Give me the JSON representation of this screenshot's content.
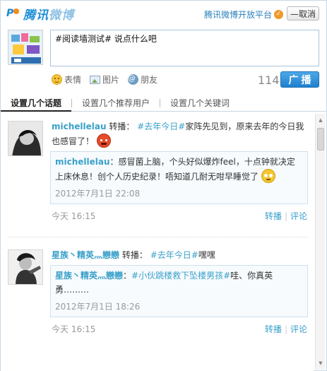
{
  "header": {
    "logo_text": "腾讯",
    "logo_text_2": "微博",
    "platform_link": "腾讯微博开放平台",
    "cancel_label": "—取消"
  },
  "composer": {
    "text": "#阅读墙测试# 说点什么吧",
    "tools": [
      {
        "icon": "smiley-icon",
        "label": "表情"
      },
      {
        "icon": "image-icon",
        "label": "图片"
      },
      {
        "icon": "at-icon",
        "label": "朋友"
      }
    ],
    "remaining_chars": "114",
    "submit_label": "广播"
  },
  "tabs": [
    {
      "label": "设置几个话题",
      "active": true
    },
    {
      "label": "设置几个推荐用户",
      "active": false
    },
    {
      "label": "设置几个关键词",
      "active": false
    }
  ],
  "posts": [
    {
      "user": "michellelau",
      "action": "转播：",
      "topic": "#去年今日#",
      "text": "家阵先见到，原来去年的今日我也感冒了！",
      "emoji": "angry-face-icon",
      "inner": {
        "user": "michellelau",
        "text": "：感冒菌上脑，个头好似爆炸feel，十点钟就决定上床休息！创个人历史纪录！唔知道几耐无咁早睡觉了",
        "emoji": "crying-face-icon",
        "time": "2012年7月1日 22:08"
      },
      "time": "今天 16:15",
      "actions": [
        "转播",
        "评论"
      ]
    },
    {
      "user": "星族丶精英灬戀戀",
      "action": "转播：",
      "topic": "#去年今日#",
      "text": "嘿嘿",
      "inner": {
        "user": "星族丶精英灬戀戀",
        "text": "：",
        "topic": "#小伙跳楼救下坠楼男孩#",
        "text_after": "哇、你真英勇………",
        "time": "2012年7月1日 18:26"
      },
      "time": "今天 16:15",
      "actions": [
        "转播",
        "评论"
      ]
    }
  ]
}
